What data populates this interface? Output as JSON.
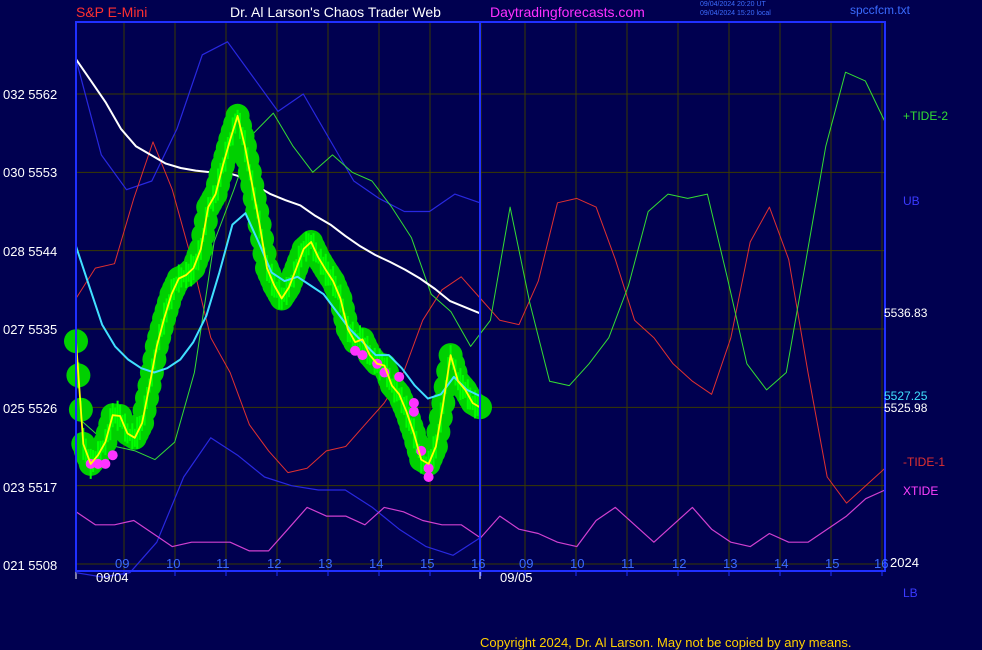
{
  "header": {
    "symbol": "S&P E-Mini",
    "site": "Dr. Al Larson's Chaos Trader Web",
    "url": "Daytradingforecasts.com",
    "ts_utc": "09/04/2024 20:20 UT",
    "ts_local": "09/04/2024 15:20 local",
    "file": "spccfcm.txt"
  },
  "colors": {
    "background": "#000050",
    "plot_border": "#2030ff",
    "grid": "#3a3a00",
    "price": "#ffff00",
    "price_glow": "#00d000",
    "price_tick": "#00ff00",
    "electric": "#ff33ff",
    "ema_fast": "#40e0ff",
    "ema_slow": "#ffffff",
    "tide_plus2": "#33dd33",
    "tide_minus1": "#e03030",
    "xtide": "#d040d0",
    "band": "#2828e0"
  },
  "chart_data": {
    "type": "line",
    "title": "S&P E-Mini",
    "y_ticks": [
      {
        "label": "021 5508",
        "value": 5508
      },
      {
        "label": "023 5517",
        "value": 5517
      },
      {
        "label": "025 5526",
        "value": 5526
      },
      {
        "label": "027 5535",
        "value": 5535
      },
      {
        "label": "028 5544",
        "value": 5544
      },
      {
        "label": "030 5553",
        "value": 5553
      },
      {
        "label": "032 5562",
        "value": 5562
      }
    ],
    "ylim": [
      5508,
      5562
    ],
    "x_hour_ticks": [
      "09",
      "10",
      "11",
      "12",
      "13",
      "14",
      "15",
      "16",
      "09",
      "10",
      "11",
      "12",
      "13",
      "14",
      "15",
      "16"
    ],
    "date_labels": [
      "09/04",
      "09/05"
    ],
    "year_label": "2024",
    "right_labels": {
      "tide_plus2": "+TIDE-2",
      "ub": "UB",
      "last_close": "5536.83",
      "ema_fast_val": "5527.25",
      "price_val": "5525.98",
      "tide_minus1": "-TIDE-1",
      "xtide": "XTIDE",
      "lb": "LB"
    },
    "series": [
      {
        "key": "price",
        "values": [
          5533.6,
          5521.8,
          5519.5,
          5520.5,
          5522.0,
          5525.1,
          5525.0,
          5523.0,
          5522.5,
          5524.2,
          5528.5,
          5533.0,
          5536.2,
          5539.0,
          5540.8,
          5541.2,
          5542.0,
          5544.2,
          5549.0,
          5550.5,
          5553.8,
          5556.8,
          5559.5,
          5556.0,
          5551.5,
          5547.0,
          5542.0,
          5540.0,
          5538.5,
          5539.8,
          5542.0,
          5544.2,
          5545.0,
          5543.2,
          5541.8,
          5540.5,
          5538.5,
          5535.0,
          5533.5,
          5533.8,
          5532.0,
          5531.0,
          5530.8,
          5528.5,
          5527.5,
          5525.5,
          5523.0,
          5520.0,
          5519.5,
          5521.5,
          5526.5,
          5532.0,
          5529.0,
          5528.0,
          5526.5,
          5526.0
        ]
      },
      {
        "key": "ema_fast",
        "values": [
          5544.5,
          5540.0,
          5535.5,
          5533.0,
          5531.5,
          5530.5,
          5530.0,
          5530.5,
          5531.5,
          5533.5,
          5536.5,
          5541.5,
          5547.0,
          5548.3,
          5545.0,
          5541.5,
          5540.5,
          5541.0,
          5540.0,
          5539.0,
          5537.0,
          5535.0,
          5533.5,
          5532.0,
          5532.0,
          5530.5,
          5528.5,
          5527.0,
          5527.5,
          5529.5,
          5528.0,
          5527.3
        ]
      },
      {
        "key": "ema_slow",
        "values": [
          5566.0,
          5563.5,
          5561.0,
          5558.0,
          5556.0,
          5555.0,
          5554.0,
          5553.5,
          5553.2,
          5553.0,
          5553.0,
          5552.5,
          5551.5,
          5550.5,
          5549.8,
          5549.2,
          5548.0,
          5547.0,
          5545.7,
          5544.5,
          5543.5,
          5542.7,
          5541.8,
          5540.8,
          5539.6,
          5538.2,
          5537.5,
          5536.8
        ]
      },
      {
        "key": "tide_plus2",
        "values": [
          5525.0,
          5523.0,
          5521.5,
          5521.0,
          5520.0,
          5522.0,
          5530.0,
          5545.0,
          5551.0,
          5557.5,
          5559.8,
          5556.0,
          5553.0,
          5555.0,
          5553.0,
          5552.0,
          5549.0,
          5545.5,
          5539.0,
          5537.0,
          5533.0,
          5536.0,
          5549.0,
          5538.0,
          5529.0,
          5528.5,
          5531.0,
          5534.0,
          5540.0,
          5548.5,
          5550.5,
          5550.0,
          5550.5,
          5541.0,
          5531.0,
          5528.0,
          5530.0,
          5543.0,
          5556.0,
          5564.5,
          5563.5,
          5558.8
        ]
      },
      {
        "key": "tide_minus1",
        "values": [
          5538.5,
          5542.0,
          5542.5,
          5550.0,
          5556.5,
          5551.0,
          5543.0,
          5534.0,
          5530.0,
          5524.0,
          5521.0,
          5518.5,
          5519.0,
          5521.0,
          5521.5,
          5524.0,
          5526.5,
          5530.0,
          5536.0,
          5539.5,
          5541.0,
          5538.5,
          5536.0,
          5535.5,
          5540.5,
          5549.5,
          5550.0,
          5549.0,
          5543.0,
          5536.0,
          5534.0,
          5531.0,
          5529.0,
          5527.5,
          5534.0,
          5545.0,
          5549.0,
          5543.0,
          5530.0,
          5518.0,
          5515.0,
          5517.0,
          5519.0
        ]
      },
      {
        "key": "xtide",
        "values": [
          5514.0,
          5512.5,
          5512.5,
          5513.0,
          5511.5,
          5510.0,
          5510.5,
          5510.5,
          5510.5,
          5509.5,
          5509.5,
          5512.0,
          5514.5,
          5513.5,
          5513.5,
          5512.5,
          5514.5,
          5514.0,
          5513.0,
          5512.5,
          5512.5,
          5511.0,
          5513.5,
          5512.0,
          5511.5,
          5510.5,
          5510.0,
          5513.0,
          5514.5,
          5512.5,
          5510.5,
          5512.5,
          5514.5,
          5512.0,
          5510.5,
          5510.0,
          5511.5,
          5510.5,
          5510.5,
          5512.0,
          5513.5,
          5515.5,
          5516.5
        ]
      },
      {
        "key": "ub",
        "values": [
          5566.0,
          5555.0,
          5551.0,
          5552.0,
          5558.0,
          5566.5,
          5568.0,
          5564.0,
          5560.0,
          5562.0,
          5557.0,
          5552.0,
          5550.0,
          5548.5,
          5548.5,
          5550.5,
          5549.5
        ]
      },
      {
        "key": "lb",
        "values": [
          5507.0,
          5506.5,
          5507.0,
          5510.5,
          5518.0,
          5522.5,
          5520.5,
          5518.0,
          5517.0,
          5516.5,
          5516.5,
          5514.5,
          5512.0,
          5510.0,
          5509.0,
          5511.0
        ]
      }
    ]
  },
  "copyright": "Copyright 2024, Dr. Al Larson. May not be copied by any means."
}
